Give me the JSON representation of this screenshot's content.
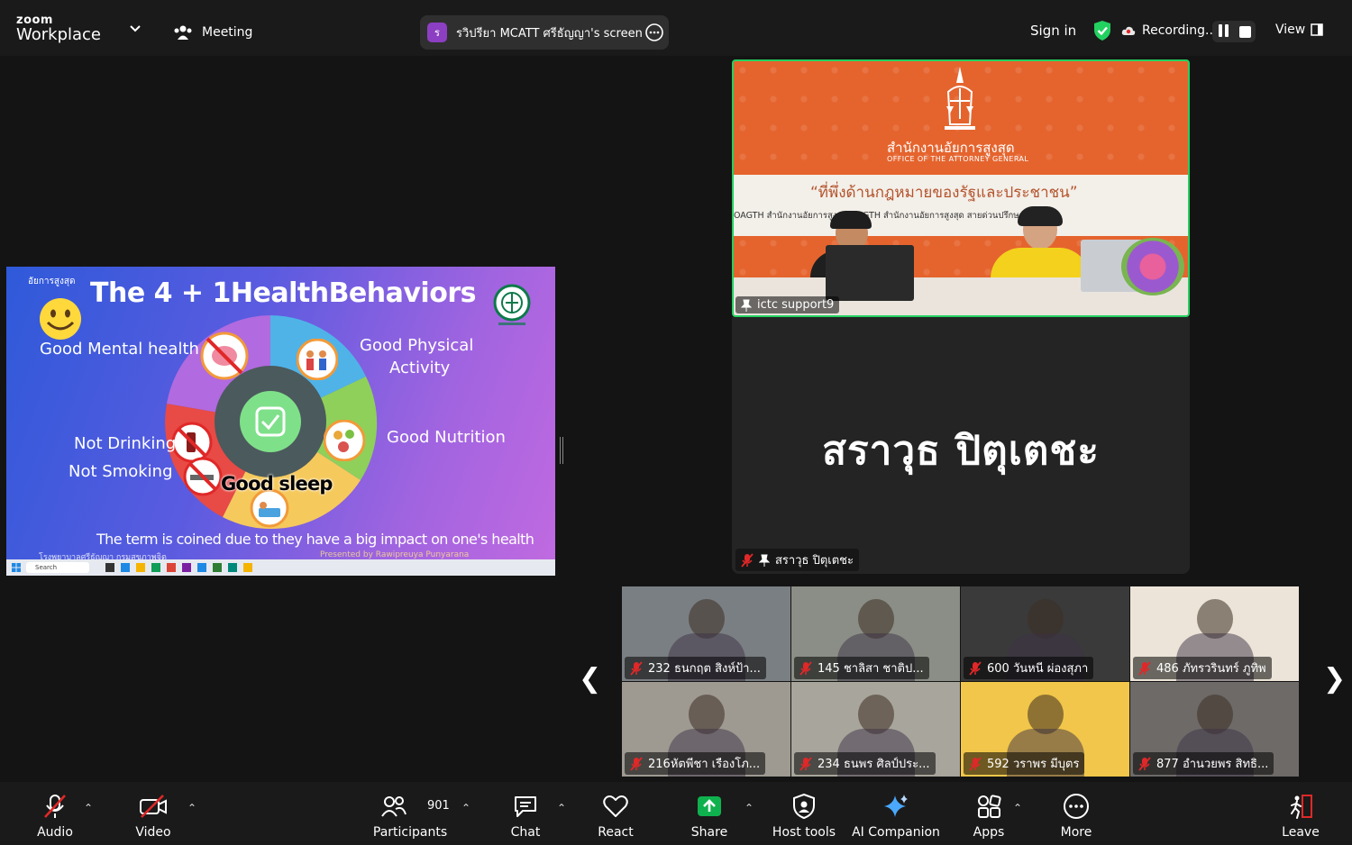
{
  "app": {
    "brand_top": "zoom",
    "brand_bottom": "Workplace",
    "meeting_label": "Meeting"
  },
  "share": {
    "avatar_letter": "ร",
    "label": "รวิปรียา MCATT ศรีธัญญา's screen"
  },
  "header": {
    "sign_in": "Sign in",
    "recording": "Recording...",
    "view": "View"
  },
  "slide": {
    "tag": "อัยการสูงสุด",
    "title": "The 4 + 1HealthBehaviors",
    "labels": {
      "mental": "Good Mental health",
      "physical_1": "Good Physical",
      "physical_2": "Activity",
      "nutrition": "Good Nutrition",
      "drinking": "Not Drinking",
      "smoking": "Not Smoking",
      "sleep": "Good sleep"
    },
    "footer": "The term is coined due to they have a big impact on one's health",
    "footer_left": "โรงพยาบาลศรีธัญญา กรมสุขภาพจิต",
    "footer_right": "Presented by Rawipreuya Punyarana",
    "search": "Search"
  },
  "speaker": {
    "org_th": "สำนักงานอัยการสูงสุด",
    "org_en": "OFFICE OF THE ATTORNEY GENERAL",
    "banner_quote": "“ที่พึ่งด้านกฎหมายของรัฐและประชาชน”",
    "banner_links": "OAGTH   สำนักงานอัยการสูงสุด OAGTH   สำนักงานอัยการสูงสุด   สายด่วนปรึกษากฎหมาย",
    "name": "ictc support9"
  },
  "name_tile": {
    "big_name": "สราวุธ ปิตุเตชะ",
    "small_name": "สราวุธ ปิตุเตชะ"
  },
  "gallery": [
    {
      "name": "232 ธนกฤต สิงห์ป้า...",
      "bg": "#7a7f83"
    },
    {
      "name": "145 ชาลิสา ชาติป...",
      "bg": "#8b8e86"
    },
    {
      "name": "600 วันหนี ผ่องสุภา",
      "bg": "#3a3a3a"
    },
    {
      "name": "486 ภัทรวรินทร์ ภูทิพ",
      "bg": "#ece4d8"
    },
    {
      "name": "216หัตพีชา เรืองโภ...",
      "bg": "#9e9a92"
    },
    {
      "name": "234 ธนพร ศิลป์ประ...",
      "bg": "#a8a59c"
    },
    {
      "name": "592 วราพร มีบุตร",
      "bg": "#f2c64a"
    },
    {
      "name": "877 อำนวยพร สิทธิ...",
      "bg": "#6d6a68"
    }
  ],
  "toolbar": {
    "audio": "Audio",
    "video": "Video",
    "participants": "Participants",
    "participant_count": "901",
    "chat": "Chat",
    "react": "React",
    "share": "Share",
    "host_tools": "Host tools",
    "ai_companion": "AI Companion",
    "apps": "Apps",
    "more": "More",
    "leave": "Leave"
  },
  "colors": {
    "accent_green": "#23d160",
    "share_green": "#0fb14e",
    "muted_red": "#e02828",
    "bg": "#141414"
  }
}
